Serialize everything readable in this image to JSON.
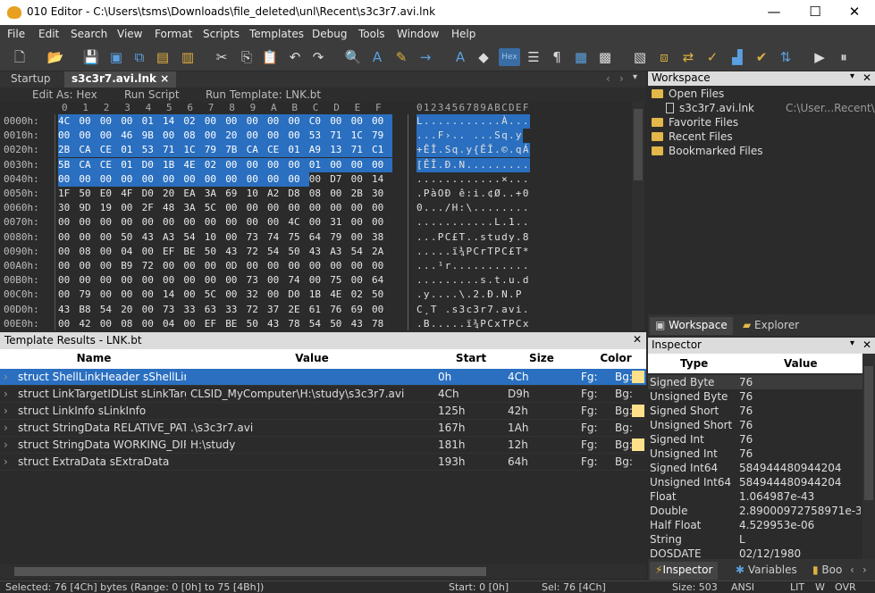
{
  "window": {
    "title": "010 Editor - C:\\Users\\tsms\\Downloads\\file_deleted\\unl\\Recent\\s3c3r7.avi.lnk",
    "controls": [
      "—",
      "☐",
      "✕"
    ]
  },
  "menu": [
    "File",
    "Edit",
    "Search",
    "View",
    "Format",
    "Scripts",
    "Templates",
    "Debug",
    "Tools",
    "Window",
    "Help"
  ],
  "toolbar": {
    "hex_label": "Hex"
  },
  "tabs": {
    "startup": "Startup",
    "file": "s3c3r7.avi.lnk",
    "close": "×"
  },
  "editbar": {
    "edit_as": "Edit As: Hex",
    "run_script": "Run Script",
    "run_template": "Run Template: LNK.bt"
  },
  "hex": {
    "col_header": [
      "0",
      "1",
      "2",
      "3",
      "4",
      "5",
      "6",
      "7",
      "8",
      "9",
      "A",
      "B",
      "C",
      "D",
      "E",
      "F"
    ],
    "ascii_header": "0123456789ABCDEF",
    "rows": [
      {
        "addr": "0000h:",
        "bytes": [
          "4C",
          "00",
          "00",
          "00",
          "01",
          "14",
          "02",
          "00",
          "00",
          "00",
          "00",
          "00",
          "C0",
          "00",
          "00",
          "00"
        ],
        "sel": 16,
        "ascii": "L...........À..."
      },
      {
        "addr": "0010h:",
        "bytes": [
          "00",
          "00",
          "00",
          "46",
          "9B",
          "00",
          "08",
          "00",
          "20",
          "00",
          "00",
          "00",
          "53",
          "71",
          "1C",
          "79"
        ],
        "sel": 16,
        "ascii": "...F›.. ...Sq.y"
      },
      {
        "addr": "0020h:",
        "bytes": [
          "2B",
          "CA",
          "CE",
          "01",
          "53",
          "71",
          "1C",
          "79",
          "7B",
          "CA",
          "CE",
          "01",
          "A9",
          "13",
          "71",
          "C1"
        ],
        "sel": 16,
        "ascii": "+ÊÎ.Sq.y{ÊÎ.©.qÁ"
      },
      {
        "addr": "0030h:",
        "bytes": [
          "5B",
          "CA",
          "CE",
          "01",
          "D0",
          "1B",
          "4E",
          "02",
          "00",
          "00",
          "00",
          "00",
          "01",
          "00",
          "00",
          "00"
        ],
        "sel": 16,
        "ascii": "[ÊÎ.Ð.N........."
      },
      {
        "addr": "0040h:",
        "bytes": [
          "00",
          "00",
          "00",
          "00",
          "00",
          "00",
          "00",
          "00",
          "00",
          "00",
          "00",
          "00",
          "00",
          "D7",
          "00",
          "14",
          "00"
        ],
        "sel": 12,
        "ascii": "............×..."
      },
      {
        "addr": "0050h:",
        "bytes": [
          "1F",
          "50",
          "E0",
          "4F",
          "D0",
          "20",
          "EA",
          "3A",
          "69",
          "10",
          "A2",
          "D8",
          "08",
          "00",
          "2B",
          "30"
        ],
        "sel": 0,
        "ascii": ".PàOÐ ê:i.¢Ø..+0"
      },
      {
        "addr": "0060h:",
        "bytes": [
          "30",
          "9D",
          "19",
          "00",
          "2F",
          "48",
          "3A",
          "5C",
          "00",
          "00",
          "00",
          "00",
          "00",
          "00",
          "00",
          "00"
        ],
        "sel": 0,
        "ascii": "0...​/H:\\........"
      },
      {
        "addr": "0070h:",
        "bytes": [
          "00",
          "00",
          "00",
          "00",
          "00",
          "00",
          "00",
          "00",
          "00",
          "00",
          "00",
          "4C",
          "00",
          "31",
          "00",
          "00"
        ],
        "sel": 0,
        "ascii": "...........L.1.."
      },
      {
        "addr": "0080h:",
        "bytes": [
          "00",
          "00",
          "00",
          "50",
          "43",
          "A3",
          "54",
          "10",
          "00",
          "73",
          "74",
          "75",
          "64",
          "79",
          "00",
          "38"
        ],
        "sel": 0,
        "ascii": "...PC£T..study.8"
      },
      {
        "addr": "0090h:",
        "bytes": [
          "00",
          "08",
          "00",
          "04",
          "00",
          "EF",
          "BE",
          "50",
          "43",
          "72",
          "54",
          "50",
          "43",
          "A3",
          "54",
          "2A"
        ],
        "sel": 0,
        "ascii": ".....ï¾PCrTPC£T*"
      },
      {
        "addr": "00A0h:",
        "bytes": [
          "00",
          "00",
          "00",
          "B9",
          "72",
          "00",
          "00",
          "00",
          "0D",
          "00",
          "00",
          "00",
          "00",
          "00",
          "00",
          "00"
        ],
        "sel": 0,
        "ascii": "...¹r..........."
      },
      {
        "addr": "00B0h:",
        "bytes": [
          "00",
          "00",
          "00",
          "00",
          "00",
          "00",
          "00",
          "00",
          "00",
          "73",
          "00",
          "74",
          "00",
          "75",
          "00",
          "64"
        ],
        "sel": 0,
        "ascii": ".........s.t.u.d"
      },
      {
        "addr": "00C0h:",
        "bytes": [
          "00",
          "79",
          "00",
          "00",
          "00",
          "14",
          "00",
          "5C",
          "00",
          "32",
          "00",
          "D0",
          "1B",
          "4E",
          "02",
          "50"
        ],
        "sel": 0,
        "ascii": ".y....\\.2.Ð.N.P"
      },
      {
        "addr": "00D0h:",
        "bytes": [
          "43",
          "B8",
          "54",
          "20",
          "00",
          "73",
          "33",
          "63",
          "33",
          "72",
          "37",
          "2E",
          "61",
          "76",
          "69",
          "00"
        ],
        "sel": 0,
        "ascii": "C¸T .s3c3r7.avi."
      },
      {
        "addr": "00E0h:",
        "bytes": [
          "00",
          "42",
          "00",
          "08",
          "00",
          "04",
          "00",
          "EF",
          "BE",
          "50",
          "43",
          "78",
          "54",
          "50",
          "43",
          "78"
        ],
        "sel": 0,
        "ascii": ".B.....ï¾PCxTPCx"
      }
    ]
  },
  "template": {
    "title": "Template Results - LNK.bt",
    "columns": [
      "Name",
      "Value",
      "Start",
      "Size",
      "Color"
    ],
    "rows": [
      {
        "name": "struct ShellLinkHeader sShellLink...",
        "value": "",
        "start": "0h",
        "size": "4Ch",
        "fg": "Fg:",
        "bg": "Bg:",
        "swatch": true,
        "sel": true
      },
      {
        "name": "struct LinkTargetIDList sLinkTarge...",
        "value": "CLSID_MyComputer\\H:\\study\\s3c3r7.avi",
        "start": "4Ch",
        "size": "D9h",
        "fg": "Fg:",
        "bg": "Bg:",
        "swatch": false,
        "sel": false
      },
      {
        "name": "struct LinkInfo sLinkInfo",
        "value": "",
        "start": "125h",
        "size": "42h",
        "fg": "Fg:",
        "bg": "Bg:",
        "swatch": true,
        "sel": false
      },
      {
        "name": "struct StringData RELATIVE_PATH",
        "value": ".\\s3c3r7.avi",
        "start": "167h",
        "size": "1Ah",
        "fg": "Fg:",
        "bg": "Bg:",
        "swatch": false,
        "sel": false
      },
      {
        "name": "struct StringData WORKING_DIR",
        "value": "H:\\study",
        "start": "181h",
        "size": "12h",
        "fg": "Fg:",
        "bg": "Bg:",
        "swatch": true,
        "sel": false
      },
      {
        "name": "struct ExtraData sExtraData",
        "value": "",
        "start": "193h",
        "size": "64h",
        "fg": "Fg:",
        "bg": "Bg:",
        "swatch": false,
        "sel": false
      }
    ]
  },
  "workspace": {
    "title": "Workspace",
    "open_files": "Open Files",
    "file_name": "s3c3r7.avi.lnk",
    "file_path": "C:\\User...Recent\\",
    "favorite": "Favorite Files",
    "recent": "Recent Files",
    "bookmarked": "Bookmarked Files",
    "tab_workspace": "Workspace",
    "tab_explorer": "Explorer"
  },
  "inspector": {
    "title": "Inspector",
    "columns": [
      "Type",
      "Value"
    ],
    "rows": [
      {
        "type": "Signed Byte",
        "value": "76"
      },
      {
        "type": "Unsigned Byte",
        "value": "76"
      },
      {
        "type": "Signed Short",
        "value": "76"
      },
      {
        "type": "Unsigned Short",
        "value": "76"
      },
      {
        "type": "Signed Int",
        "value": "76"
      },
      {
        "type": "Unsigned Int",
        "value": "76"
      },
      {
        "type": "Signed Int64",
        "value": "584944480944204"
      },
      {
        "type": "Unsigned Int64",
        "value": "584944480944204"
      },
      {
        "type": "Float",
        "value": "1.064987e-43"
      },
      {
        "type": "Double",
        "value": "2.89000972758971e-3..."
      },
      {
        "type": "Half Float",
        "value": "4.529953e-06"
      },
      {
        "type": "String",
        "value": "L"
      },
      {
        "type": "DOSDATE",
        "value": "02/12/1980"
      }
    ],
    "tab_inspector": "Inspector",
    "tab_variables": "Variables",
    "tab_bookmarks": "Boo"
  },
  "status": {
    "selected": "Selected: 76 [4Ch] bytes (Range: 0 [0h] to 75 [4Bh])",
    "start": "Start: 0 [0h]",
    "sel": "Sel: 76 [4Ch]",
    "size": "Size: 503",
    "encoding": "ANSI",
    "lit": "LIT",
    "w": "W",
    "ovr": "OVR"
  }
}
